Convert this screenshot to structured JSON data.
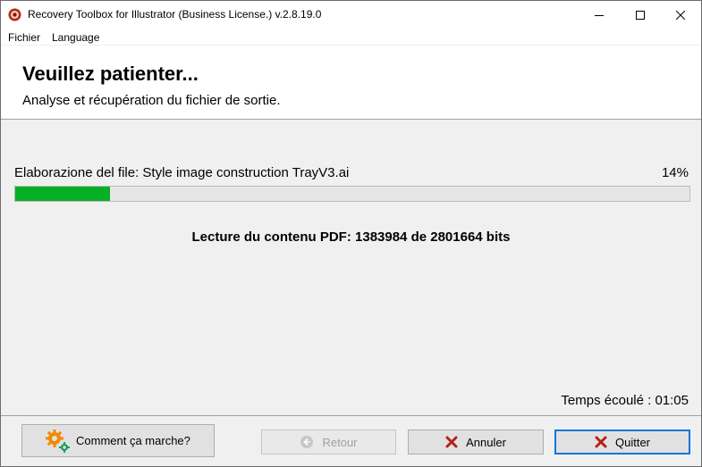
{
  "window": {
    "title": "Recovery Toolbox for Illustrator (Business License.) v.2.8.19.0"
  },
  "menu": {
    "items": [
      "Fichier",
      "Language"
    ]
  },
  "header": {
    "title": "Veuillez patienter...",
    "subtitle": "Analyse et récupération du fichier de sortie."
  },
  "progress": {
    "label": "Elaborazione del file: Style image construction TrayV3.ai",
    "percent_text": "14%",
    "value": 14,
    "fill_color": "#06b025"
  },
  "status": {
    "reading": "Lecture du contenu PDF: 1383984 de 2801664 bits",
    "elapsed": "Temps écoulé : 01:05"
  },
  "buttons": {
    "help": "Comment ça marche?",
    "back": "Retour",
    "cancel": "Annuler",
    "quit": "Quitter"
  },
  "icons": {
    "app": "app-icon",
    "help": "gears-icon",
    "back": "back-arrow-icon",
    "cancel": "red-x-icon",
    "quit": "red-x-icon"
  }
}
